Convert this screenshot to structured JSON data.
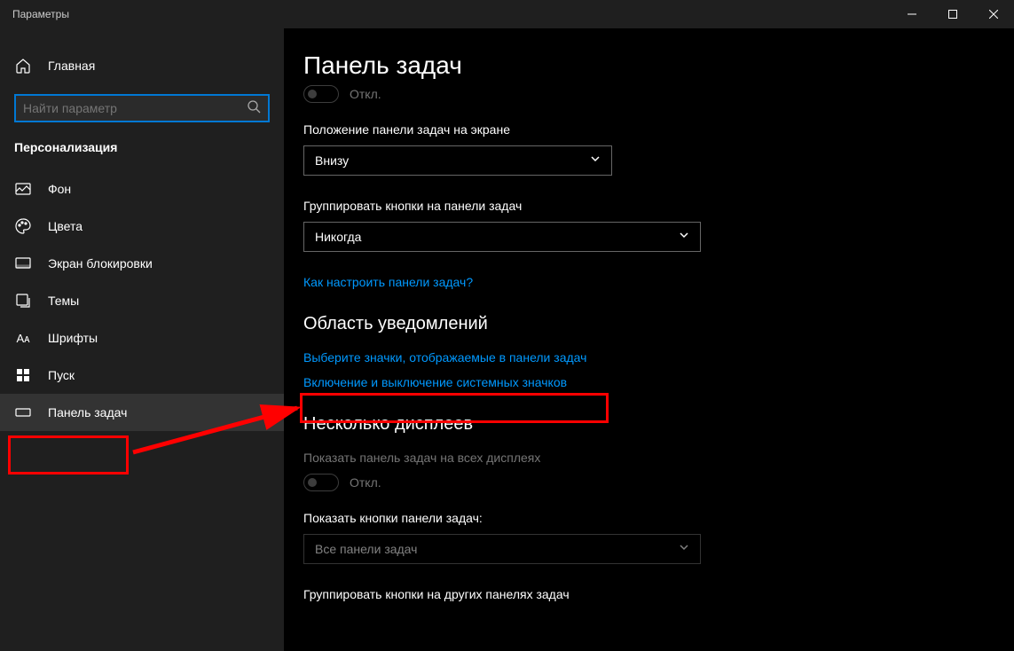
{
  "window": {
    "title": "Параметры"
  },
  "sidebar": {
    "home": "Главная",
    "search_placeholder": "Найти параметр",
    "category": "Персонализация",
    "items": [
      {
        "label": "Фон"
      },
      {
        "label": "Цвета"
      },
      {
        "label": "Экран блокировки"
      },
      {
        "label": "Темы"
      },
      {
        "label": "Шрифты"
      },
      {
        "label": "Пуск"
      },
      {
        "label": "Панель задач"
      }
    ]
  },
  "content": {
    "title": "Панель задач",
    "toggle_off_1": "Откл.",
    "position_label": "Положение панели задач на экране",
    "position_value": "Внизу",
    "group_label": "Группировать кнопки на панели задач",
    "group_value": "Никогда",
    "help_link": "Как настроить панели задач?",
    "notif_area_title": "Область уведомлений",
    "notif_link_1": "Выберите значки, отображаемые в панели задач",
    "notif_link_2": "Включение и выключение системных значков",
    "multi_title": "Несколько дисплеев",
    "multi_show_label": "Показать панель задач на всех дисплеях",
    "toggle_off_2": "Откл.",
    "multi_buttons_label": "Показать кнопки панели задач:",
    "multi_buttons_value": "Все панели задач",
    "multi_group_label": "Группировать кнопки на других панелях задач"
  }
}
